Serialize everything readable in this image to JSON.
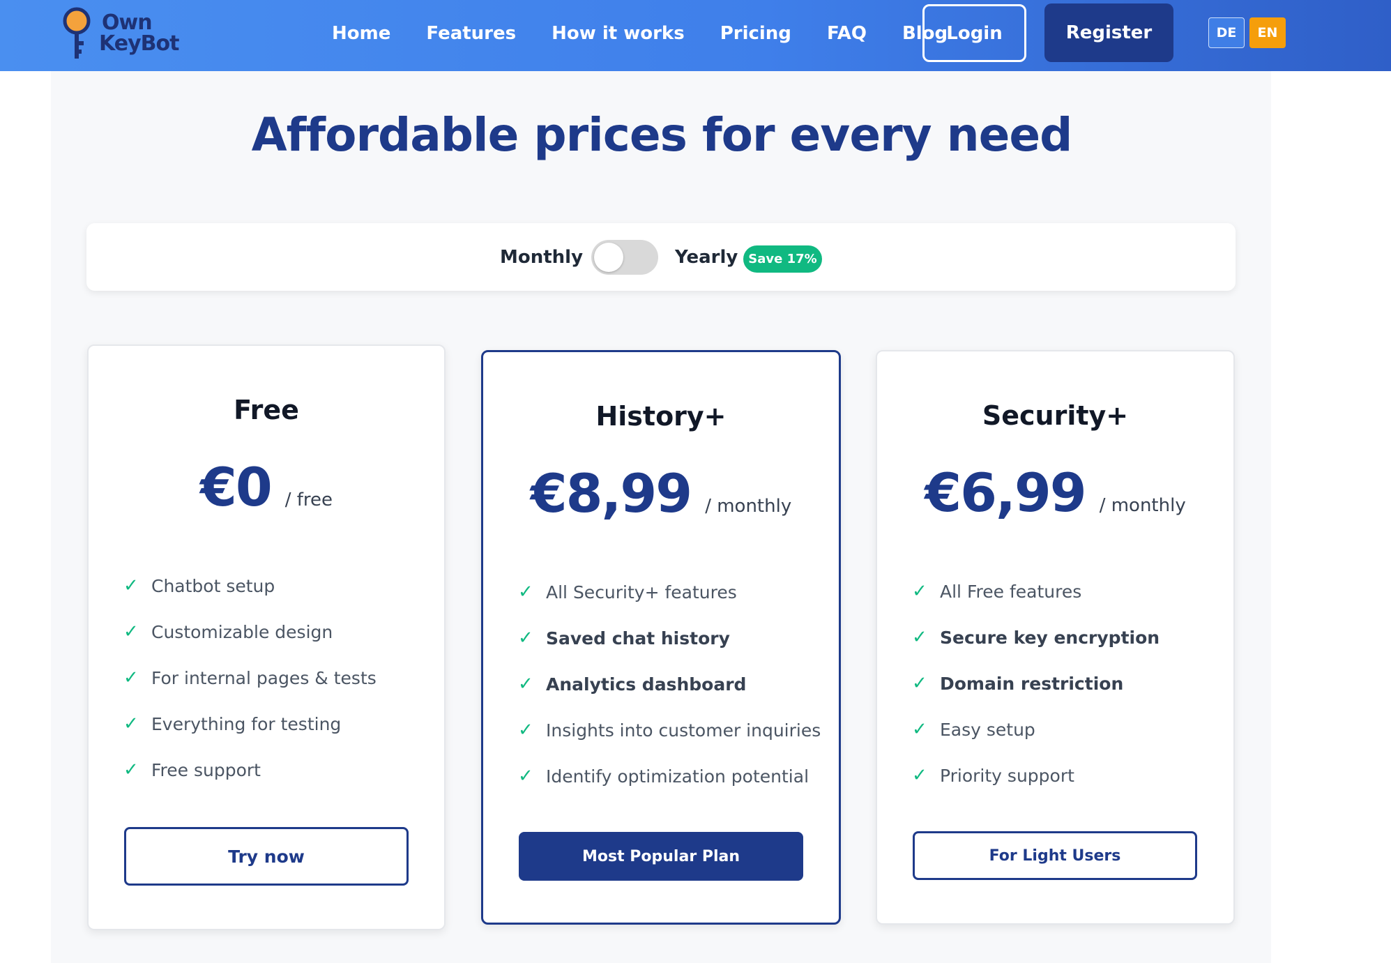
{
  "header": {
    "logo": {
      "line1": "Own",
      "line2": "KeyBot"
    },
    "nav": [
      "Home",
      "Features",
      "How it works",
      "Pricing",
      "FAQ",
      "Blog"
    ],
    "login_label": "Login",
    "register_label": "Register",
    "languages": [
      "DE",
      "EN"
    ],
    "active_language": "EN"
  },
  "main": {
    "title": "Affordable prices for every need",
    "billing": {
      "monthly_label": "Monthly",
      "yearly_label": "Yearly",
      "save_badge": "Save 17%",
      "yearly_enabled": false
    },
    "plans": [
      {
        "name": "Free",
        "price": "€0",
        "period": "/ free",
        "features": [
          {
            "text": "Chatbot setup",
            "bold": false
          },
          {
            "text": "Customizable design",
            "bold": false
          },
          {
            "text": "For internal pages & tests",
            "bold": false
          },
          {
            "text": "Everything for testing",
            "bold": false
          },
          {
            "text": "Free support",
            "bold": false
          }
        ],
        "button_label": "Try now"
      },
      {
        "name": "History+",
        "price": "€8,99",
        "period": "/ monthly",
        "features": [
          {
            "text": "All Security+ features",
            "bold": false
          },
          {
            "text": "Saved chat history",
            "bold": true
          },
          {
            "text": "Analytics dashboard",
            "bold": true
          },
          {
            "text": "Insights into customer inquiries",
            "bold": false
          },
          {
            "text": "Identify optimization potential",
            "bold": false
          }
        ],
        "button_label": "Most Popular Plan"
      },
      {
        "name": "Security+",
        "price": "€6,99",
        "period": "/ monthly",
        "features": [
          {
            "text": "All Free features",
            "bold": false
          },
          {
            "text": "Secure key encryption",
            "bold": true
          },
          {
            "text": "Domain restriction",
            "bold": true
          },
          {
            "text": "Easy setup",
            "bold": false
          },
          {
            "text": "Priority support",
            "bold": false
          }
        ],
        "button_label": "For Light Users"
      }
    ]
  },
  "colors": {
    "primary": "#1e3a8a",
    "accent_green": "#10b981",
    "language_active": "#f59e0b"
  }
}
